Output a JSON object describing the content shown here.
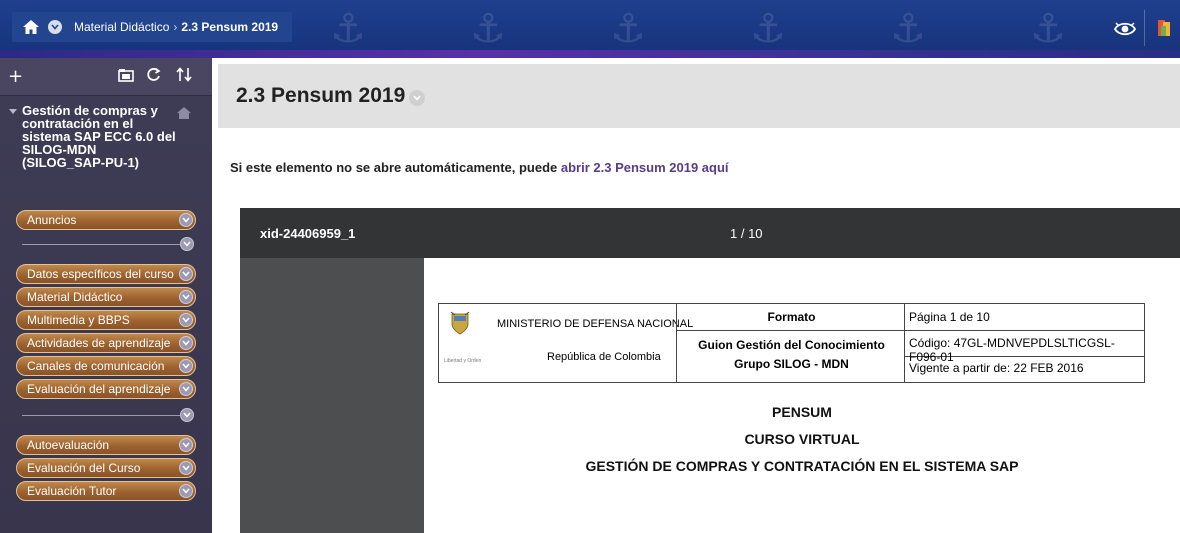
{
  "topbar": {
    "breadcrumb_parent": "Material Didáctico",
    "breadcrumb_separator": "›",
    "breadcrumb_current": "2.3 Pensum 2019",
    "accent": "#1f3f8e"
  },
  "sidebar": {
    "tools": {
      "add": "+",
      "folder": "folder-icon",
      "refresh": "refresh-icon",
      "sort": "sort-icon"
    },
    "course_title": "Gestión de compras y contratación en el sistema SAP ECC 6.0 del SILOG-MDN (SILOG_SAP-PU-1)",
    "items": [
      {
        "label": "Anuncios"
      },
      {
        "label": "Datos específicos del curso"
      },
      {
        "label": "Material Didáctico"
      },
      {
        "label": "Multimedia y BBPS"
      },
      {
        "label": "Actividades de aprendizaje"
      },
      {
        "label": "Canales de comunicación"
      },
      {
        "label": "Evaluación del aprendizaje"
      },
      {
        "label": "Autoevaluación"
      },
      {
        "label": "Evaluación del Curso"
      },
      {
        "label": "Evaluación Tutor"
      }
    ]
  },
  "content": {
    "title": "2.3 Pensum 2019",
    "notice_text": "Si este elemento no se abre automáticamente, puede ",
    "notice_link": "abrir 2.3 Pensum 2019 aquí",
    "link_color": "#5a3a8a"
  },
  "viewer": {
    "file_id": "xid-24406959_1",
    "page_counter": "1 / 10"
  },
  "document": {
    "ministry": "MINISTERIO DE DEFENSA NACIONAL",
    "republic": "República de Colombia",
    "seal_caption": "Libertad y Orden",
    "format_label": "Formato",
    "guide_line1": "Guion Gestión del Conocimiento",
    "guide_line2": "Grupo SILOG - MDN",
    "page_info": "Página 1 de 10",
    "code": "Código:  47GL-MDNVEPDLSLTICGSL-F096-01",
    "valid_from": "Vigente a partir de: 22 FEB 2016",
    "heading1": "PENSUM",
    "heading2": "CURSO VIRTUAL",
    "heading3": "GESTIÓN DE COMPRAS Y CONTRATACIÓN EN EL SISTEMA SAP"
  }
}
